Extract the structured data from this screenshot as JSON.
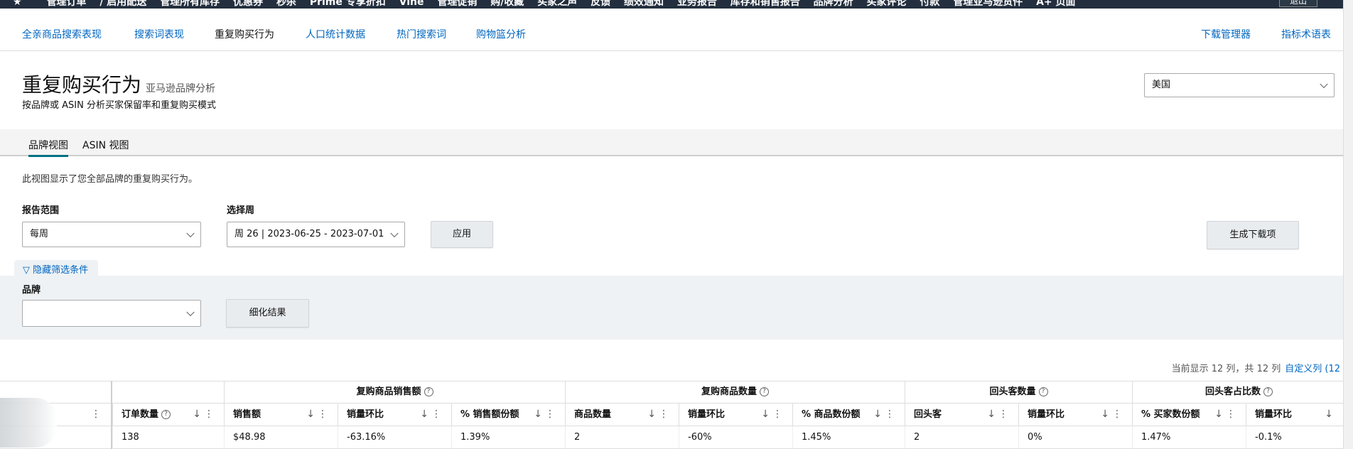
{
  "topnav": {
    "items": [
      "管理订单",
      "/ 启用配送",
      "管理所有库存",
      "优惠券",
      "秒杀",
      "Prime 专享折扣",
      "Vine",
      "管理促销",
      "购/收藏",
      "买家之声",
      "反馈",
      "绩效通知",
      "业务报告",
      "库存和销售报告",
      "品牌分析",
      "买家评论",
      "付款",
      "管理亚马逊货件",
      "A+ 页面"
    ],
    "logout": "退出"
  },
  "subnav": {
    "items": [
      "全亲商品搜索表现",
      "搜索词表现",
      "重复购买行为",
      "人口统计数据",
      "热门搜索词",
      "购物篮分析"
    ],
    "right": [
      "下载管理器",
      "指标术语表"
    ]
  },
  "page": {
    "title": "重复购买行为",
    "subtitle": "亚马逊品牌分析",
    "description": "按品牌或 ASIN 分析买家保留率和重复购买模式",
    "country": "美国"
  },
  "tabs": [
    "品牌视图",
    "ASIN 视图"
  ],
  "view_note": "此视图显示了您全部品牌的重复购买行为。",
  "filters": {
    "range_label": "报告范围",
    "range_value": "每周",
    "week_label": "选择周",
    "week_value": "周 26 | 2023-06-25 - 2023-07-01",
    "apply": "应用",
    "generate": "生成下载项",
    "hide_filters": "隐藏筛选条件",
    "brand_label": "品牌",
    "brand_value": "",
    "refine": "细化结果"
  },
  "table_meta": {
    "count_text": "当前显示 12 列，共 12 列",
    "customize": "自定义列 (12"
  },
  "table": {
    "groups": [
      "复购商品销售额",
      "复购商品数量",
      "回头客数量",
      "回头客占比数"
    ],
    "headers": [
      "订单数量",
      "销售额",
      "销量环比",
      "% 销售额份额",
      "商品数量",
      "销量环比",
      "% 商品数份额",
      "回头客",
      "销量环比",
      "% 买家数份额",
      "销量环比"
    ],
    "rows": [
      [
        "138",
        "$48.98",
        "-63.16%",
        "1.39%",
        "2",
        "-60%",
        "1.45%",
        "2",
        "0%",
        "1.47%",
        "-0.1%"
      ]
    ]
  },
  "icons": {
    "star": "star-icon",
    "sort": "sort-down-icon",
    "menu": "column-menu-icon",
    "help": "help-icon",
    "filter": "filter-icon",
    "chevron": "chevron-down-icon"
  }
}
